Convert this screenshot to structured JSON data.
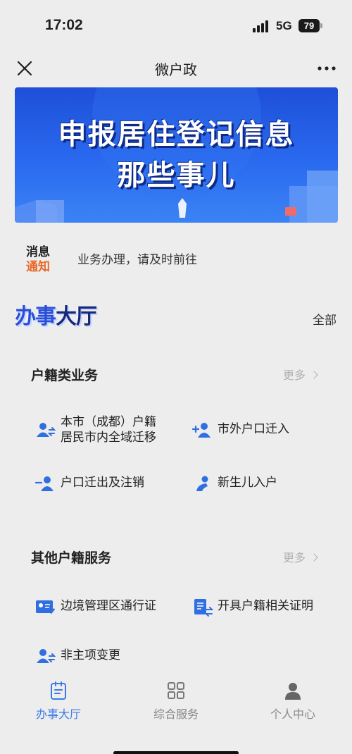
{
  "status": {
    "time": "17:02",
    "network": "5G",
    "battery": "79"
  },
  "nav": {
    "title": "微户政"
  },
  "banner": {
    "line1": "申报居住登记信息",
    "line2": "那些事儿"
  },
  "notice": {
    "tag_line1": "消息",
    "tag_line2": "通知",
    "text": "业务办理，请及时前往"
  },
  "hall": {
    "title_part1": "办事",
    "title_part2": "大厅",
    "all_label": "全部"
  },
  "sections": [
    {
      "title": "户籍类业务",
      "more": "更多",
      "items": [
        {
          "label": "本市（成都）户籍\n居民市内全域迁移",
          "icon": "person-transfer-icon"
        },
        {
          "label": "市外户口迁入",
          "icon": "person-add-icon"
        },
        {
          "label": "户口迁出及注销",
          "icon": "person-remove-icon"
        },
        {
          "label": "新生儿入户",
          "icon": "newborn-icon"
        }
      ]
    },
    {
      "title": "其他户籍服务",
      "more": "更多",
      "items": [
        {
          "label": "边境管理区通行证",
          "icon": "pass-card-icon"
        },
        {
          "label": "开具户籍相关证明",
          "icon": "certificate-icon"
        },
        {
          "label": "非主项变更",
          "icon": "person-transfer-icon"
        }
      ]
    }
  ],
  "tabs": [
    {
      "label": "办事大厅",
      "icon": "clipboard-icon",
      "active": true
    },
    {
      "label": "综合服务",
      "icon": "grid-icon",
      "active": false
    },
    {
      "label": "个人中心",
      "icon": "user-icon",
      "active": false
    }
  ],
  "colors": {
    "accent": "#2f6fe0",
    "notice_orange": "#e8692a",
    "banner_blue": "#2a6af0"
  }
}
